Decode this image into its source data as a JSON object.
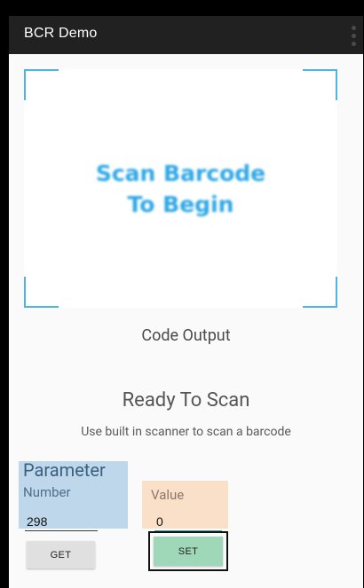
{
  "app": {
    "title": "BCR Demo"
  },
  "scanner": {
    "prompt_line1": "Scan Barcode",
    "prompt_line2": "To Begin"
  },
  "output": {
    "label": "Code Output",
    "status": "Ready To Scan",
    "hint": "Use built in scanner to scan a barcode"
  },
  "parameter": {
    "title": "Parameter",
    "subtitle": "Number",
    "value": "298"
  },
  "value_field": {
    "label": "Value",
    "value": "0"
  },
  "buttons": {
    "get_label": "GET",
    "set_label": "SET"
  },
  "colors": {
    "action_bar": "#212121",
    "scan_accent": "#2fa8e6",
    "parameter_highlight": "#bfd7ea",
    "value_highlight": "#fadfc9",
    "set_button": "#9fd8b9",
    "get_button": "#e0e0e0"
  },
  "icons": {
    "overflow": "more-vert-icon"
  }
}
